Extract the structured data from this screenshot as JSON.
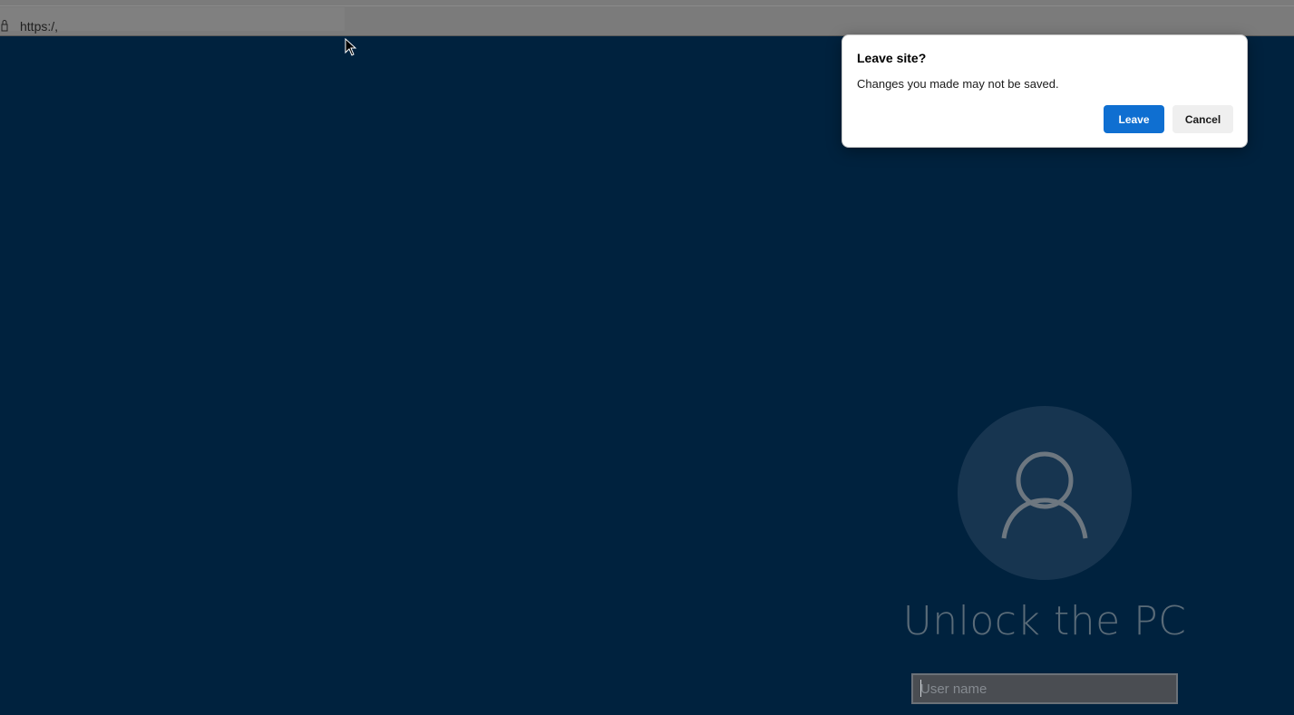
{
  "browser": {
    "url": "https:/,",
    "lock_icon": "lock-icon"
  },
  "lock_screen": {
    "avatar_icon": "user-icon",
    "title": "Unlock the PC",
    "username_placeholder": "User name",
    "background_color": "#00223e"
  },
  "dialog": {
    "title": "Leave site?",
    "message": "Changes you made may not be saved.",
    "leave_label": "Leave",
    "cancel_label": "Cancel",
    "accent_color": "#0f6fd1"
  }
}
